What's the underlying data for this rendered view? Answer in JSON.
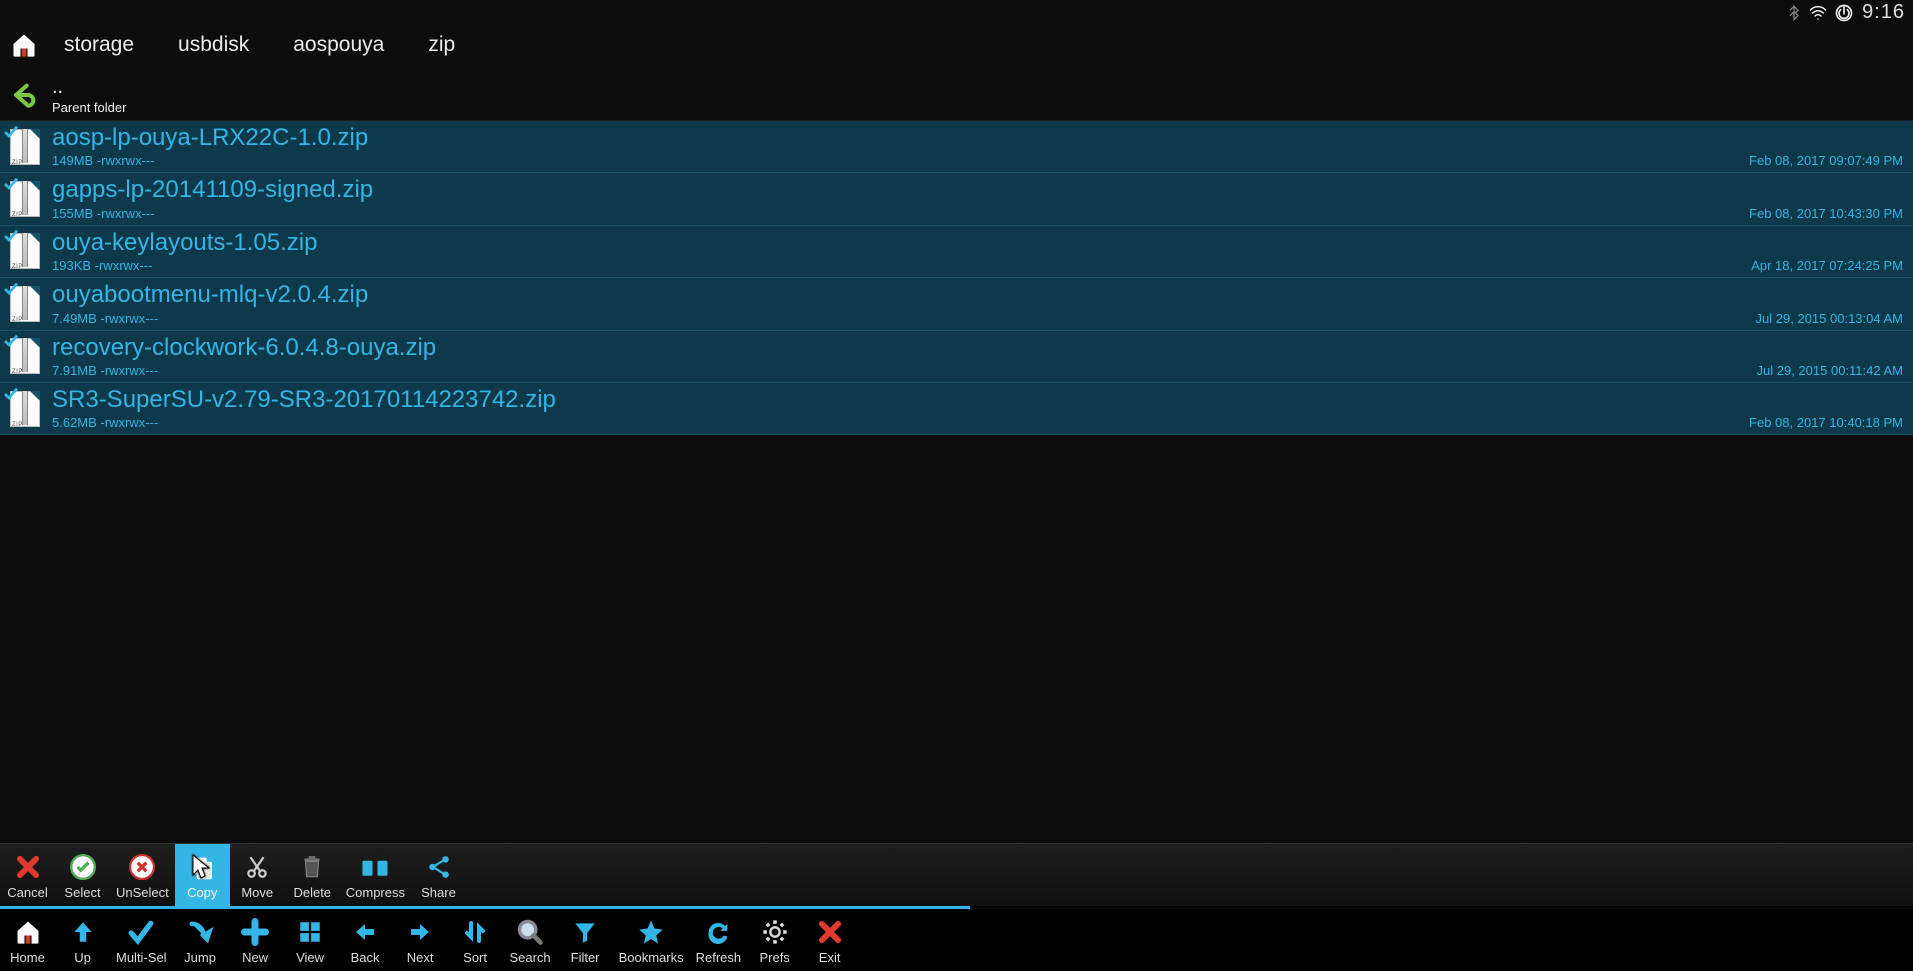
{
  "status": {
    "time": "9:16"
  },
  "breadcrumb": [
    "storage",
    "usbdisk",
    "aospouya",
    "zip"
  ],
  "parent": {
    "name": "..",
    "sub": "Parent folder"
  },
  "files": [
    {
      "name": "aosp-lp-ouya-LRX22C-1.0.zip",
      "meta": "149MB -rwxrwx---",
      "date": "Feb 08, 2017 09:07:49 PM"
    },
    {
      "name": "gapps-lp-20141109-signed.zip",
      "meta": "155MB -rwxrwx---",
      "date": "Feb 08, 2017 10:43:30 PM"
    },
    {
      "name": "ouya-keylayouts-1.05.zip",
      "meta": "193KB -rwxrwx---",
      "date": "Apr 18, 2017 07:24:25 PM"
    },
    {
      "name": "ouyabootmenu-mlq-v2.0.4.zip",
      "meta": "7.49MB -rwxrwx---",
      "date": "Jul 29, 2015 00:13:04 AM"
    },
    {
      "name": "recovery-clockwork-6.0.4.8-ouya.zip",
      "meta": "7.91MB -rwxrwx---",
      "date": "Jul 29, 2015 00:11:42 AM"
    },
    {
      "name": "SR3-SuperSU-v2.79-SR3-20170114223742.zip",
      "meta": "5.62MB -rwxrwx---",
      "date": "Feb 08, 2017 10:40:18 PM"
    }
  ],
  "toolbar1": [
    {
      "id": "cancel",
      "label": "Cancel"
    },
    {
      "id": "select",
      "label": "Select"
    },
    {
      "id": "unselect",
      "label": "UnSelect"
    },
    {
      "id": "copy",
      "label": "Copy"
    },
    {
      "id": "move",
      "label": "Move"
    },
    {
      "id": "delete",
      "label": "Delete"
    },
    {
      "id": "compress",
      "label": "Compress"
    },
    {
      "id": "share",
      "label": "Share"
    }
  ],
  "toolbar2": [
    {
      "id": "home",
      "label": "Home"
    },
    {
      "id": "up",
      "label": "Up"
    },
    {
      "id": "multisel",
      "label": "Multi-Sel"
    },
    {
      "id": "jump",
      "label": "Jump"
    },
    {
      "id": "new",
      "label": "New"
    },
    {
      "id": "view",
      "label": "View"
    },
    {
      "id": "back",
      "label": "Back"
    },
    {
      "id": "next",
      "label": "Next"
    },
    {
      "id": "sort",
      "label": "Sort"
    },
    {
      "id": "search",
      "label": "Search"
    },
    {
      "id": "filter",
      "label": "Filter"
    },
    {
      "id": "bookmarks",
      "label": "Bookmarks"
    },
    {
      "id": "refresh",
      "label": "Refresh"
    },
    {
      "id": "prefs",
      "label": "Prefs"
    },
    {
      "id": "exit",
      "label": "Exit"
    }
  ],
  "toolbar1_selected": "copy"
}
